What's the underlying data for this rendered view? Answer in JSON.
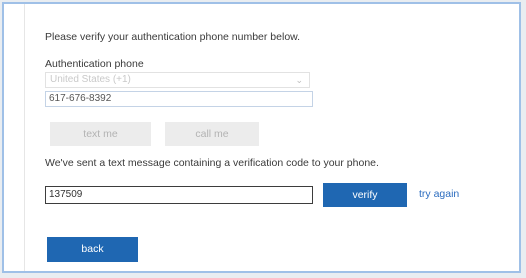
{
  "form": {
    "intro_text": "Please verify your authentication phone number below.",
    "phone_label": "Authentication phone",
    "country_select": {
      "selected": "United States (+1)"
    },
    "phone_number": "617-676-8392",
    "text_me_label": "text me",
    "call_me_label": "call me",
    "sent_message": "We've sent a text message containing a verification code to your phone.",
    "verification_code": "137509",
    "verify_label": "verify",
    "try_again_label": "try again",
    "back_label": "back"
  },
  "colors": {
    "primary_button": "#1f67b2",
    "link": "#2b6cbf",
    "disabled_button": "#ececec",
    "frame_border": "#9fc0e7"
  },
  "icons": {
    "country_dropdown": "chevron-down-icon"
  }
}
